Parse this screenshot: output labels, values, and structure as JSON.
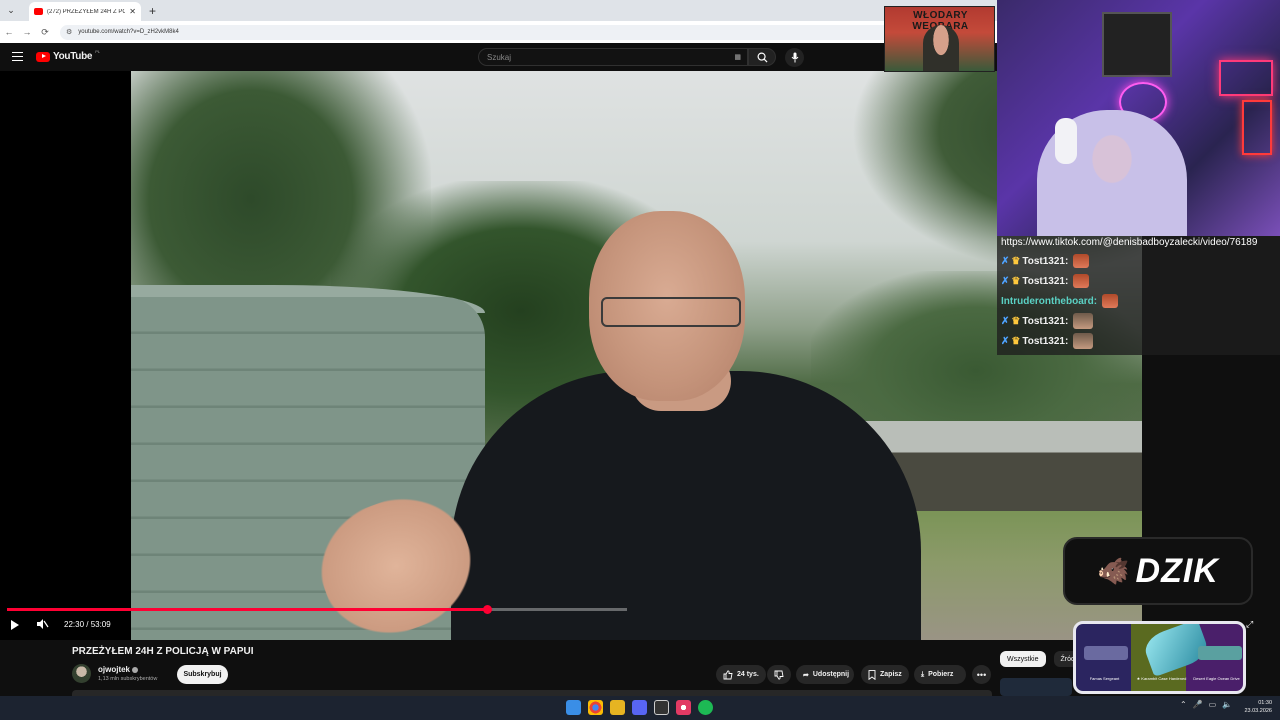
{
  "browser": {
    "tab_title": "(272) PRZEŻYŁEM 24H Z POLIC",
    "url": "youtube.com/watch?v=D_zH2vkM8k4"
  },
  "youtube": {
    "logo_text": "YouTube",
    "logo_region": "PL",
    "search_placeholder": "Szukaj"
  },
  "player": {
    "current_time": "22:30",
    "duration": "53:09",
    "time_display": "22:30 / 53:09",
    "progress_fraction": 0.4233,
    "buffered_fraction": 0.546
  },
  "video": {
    "title": "PRZEŻYŁEM 24H Z POLICJĄ W PAPUI",
    "channel_name": "ojwojtek",
    "subscribers": "1,13 mln subskrybentów",
    "subscribe_label": "Subskrybuj",
    "likes": "24 tys.",
    "share_label": "Udostępnij",
    "save_label": "Zapisz",
    "download_label": "Pobierz",
    "more_label": "•••"
  },
  "sidebar": {
    "chips": [
      "Wszystkie",
      "Źródł"
    ]
  },
  "overlay": {
    "banner_text": "WŁODARY WEOBARA",
    "chat_url": "https://www.tiktok.com/@denisbadboyzalecki/video/76189",
    "chat_messages": [
      {
        "user": "Tost1321:",
        "badges": true,
        "emote": "a"
      },
      {
        "user": "Tost1321:",
        "badges": true,
        "emote": "a"
      },
      {
        "user": "Intruderontheboard:",
        "badges": false,
        "emote": "a"
      },
      {
        "user": "Tost1321:",
        "badges": true,
        "emote": "b"
      },
      {
        "user": "Tost1321:",
        "badges": true,
        "emote": "b"
      }
    ],
    "dzik_text": "DZIK",
    "skins": [
      "Famas Sergeant",
      "★ Karambit Case Hardened",
      "Desert Eagle Ocean Drive"
    ]
  },
  "taskbar": {
    "time": "01:30",
    "date": "23.03.2026"
  },
  "colors": {
    "yt_red": "#ff0033",
    "background": "#0f0f0f",
    "chat_name_user1": "#ffffff",
    "chat_name_user2": "#5ad1c4"
  }
}
